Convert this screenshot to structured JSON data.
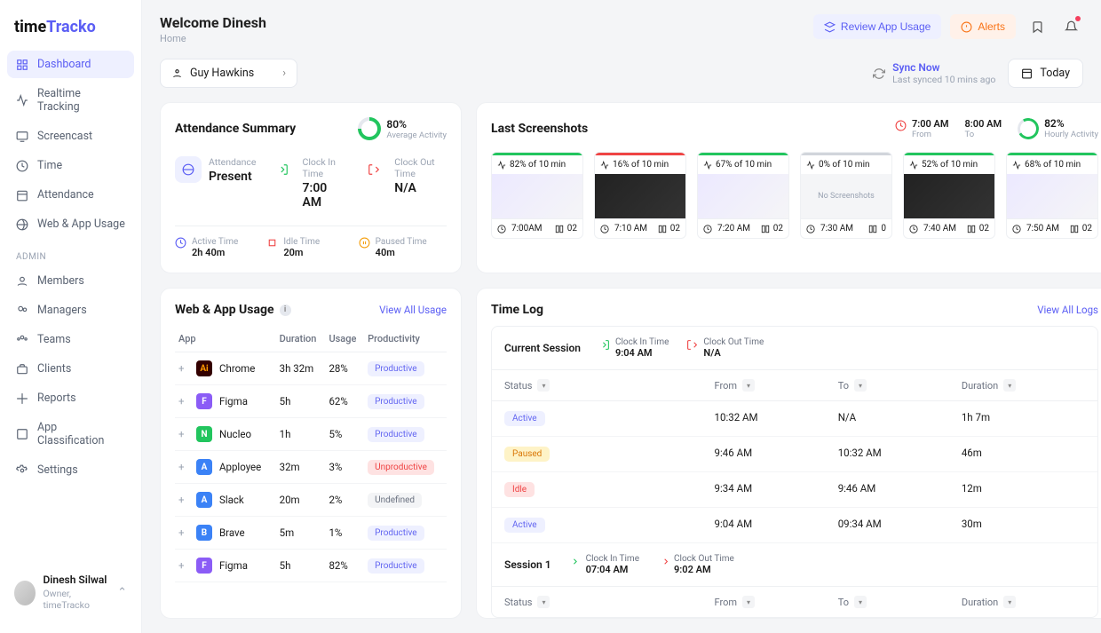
{
  "logo": {
    "pre": "time",
    "post": "Tracko"
  },
  "sidebar": {
    "items": [
      {
        "label": "Dashboard"
      },
      {
        "label": "Realtime Tracking"
      },
      {
        "label": "Screencast"
      },
      {
        "label": "Time"
      },
      {
        "label": "Attendance"
      },
      {
        "label": "Web & App Usage"
      }
    ],
    "admin_label": "ADMIN",
    "admin_items": [
      {
        "label": "Members"
      },
      {
        "label": "Managers"
      },
      {
        "label": "Teams"
      },
      {
        "label": "Clients"
      },
      {
        "label": "Reports"
      },
      {
        "label": "App Classification"
      },
      {
        "label": "Settings"
      }
    ]
  },
  "user": {
    "name": "Dinesh Silwal",
    "role": "Owner, timeTracko"
  },
  "header": {
    "welcome": "Welcome Dinesh",
    "breadcrumb": "Home",
    "review": "Review App Usage",
    "alerts": "Alerts"
  },
  "person_select": "Guy Hawkins",
  "sync": {
    "label": "Sync Now",
    "sub": "Last synced 10 mins ago"
  },
  "today": "Today",
  "attendance": {
    "title": "Attendance Summary",
    "pct": "80%",
    "pct_label": "Average Activity",
    "status_label": "Attendance",
    "status_val": "Present",
    "in_label": "Clock In Time",
    "in_val": "7:00 AM",
    "out_label": "Clock Out Time",
    "out_val": "N/A",
    "active_label": "Active Time",
    "active_val": "2h 40m",
    "idle_label": "Idle Time",
    "idle_val": "20m",
    "paused_label": "Paused Time",
    "paused_val": "40m"
  },
  "screenshots": {
    "title": "Last Screenshots",
    "from_val": "7:00 AM",
    "from_lbl": "From",
    "to_val": "8:00 AM",
    "to_lbl": "To",
    "hourly_pct": "82%",
    "hourly_lbl": "Hourly Activity",
    "items": [
      {
        "pct": "82% of 10 min",
        "time": "7:00AM",
        "count": "02",
        "bar": "green",
        "style": "light"
      },
      {
        "pct": "16% of 10 min",
        "time": "7:10 AM",
        "count": "02",
        "bar": "red",
        "style": "dark"
      },
      {
        "pct": "67% of 10 min",
        "time": "7:20 AM",
        "count": "02",
        "bar": "green",
        "style": "light"
      },
      {
        "pct": "0% of 10 min",
        "time": "7:30 AM",
        "count": "0",
        "bar": "grey",
        "style": "blank",
        "no_screenshot": "No Screenshots"
      },
      {
        "pct": "52% of 10 min",
        "time": "7:40 AM",
        "count": "02",
        "bar": "green",
        "style": "dark"
      },
      {
        "pct": "68% of 10 min",
        "time": "7:50 AM",
        "count": "02",
        "bar": "green",
        "style": "light"
      }
    ]
  },
  "usage": {
    "title": "Web & App Usage",
    "view_all": "View All Usage",
    "cols": {
      "app": "App",
      "duration": "Duration",
      "usage": "Usage",
      "prod": "Productivity"
    },
    "rows": [
      {
        "name": "Chrome",
        "icon": "Ai",
        "cls": "ai",
        "duration": "3h 32m",
        "usage": "28%",
        "prod": "Productive",
        "badge": "prod"
      },
      {
        "name": "Figma",
        "icon": "F",
        "cls": "pu",
        "duration": "5h",
        "usage": "62%",
        "prod": "Productive",
        "badge": "prod"
      },
      {
        "name": "Nucleo",
        "icon": "N",
        "cls": "gr",
        "duration": "1h",
        "usage": "5%",
        "prod": "Productive",
        "badge": "prod"
      },
      {
        "name": "Apployee",
        "icon": "A",
        "cls": "bl",
        "duration": "32m",
        "usage": "3%",
        "prod": "Unproductive",
        "badge": "unprod"
      },
      {
        "name": "Slack",
        "icon": "A",
        "cls": "bl",
        "duration": "20m",
        "usage": "2%",
        "prod": "Undefined",
        "badge": "undef"
      },
      {
        "name": "Brave",
        "icon": "B",
        "cls": "bl",
        "duration": "5m",
        "usage": "1%",
        "prod": "Productive",
        "badge": "prod"
      },
      {
        "name": "Figma",
        "icon": "F",
        "cls": "pu",
        "duration": "5h",
        "usage": "82%",
        "prod": "Productive",
        "badge": "prod"
      }
    ]
  },
  "timelog": {
    "title": "Time Log",
    "view_all": "View All Logs",
    "current": {
      "label": "Current Session",
      "in_lbl": "Clock In Time",
      "in_val": "9:04 AM",
      "out_lbl": "Clock Out Time",
      "out_val": "N/A"
    },
    "cols": {
      "status": "Status",
      "from": "From",
      "to": "To",
      "duration": "Duration"
    },
    "rows": [
      {
        "status": "Active",
        "cls": "active",
        "from": "10:32 AM",
        "to": "N/A",
        "dur": "1h 7m"
      },
      {
        "status": "Paused",
        "cls": "paused",
        "from": "9:46 AM",
        "to": "10:32 AM",
        "dur": "46m"
      },
      {
        "status": "Idle",
        "cls": "idle",
        "from": "9:34 AM",
        "to": "9:46 AM",
        "dur": "12m"
      },
      {
        "status": "Active",
        "cls": "active",
        "from": "9:04 AM",
        "to": "09:34 AM",
        "dur": "30m"
      }
    ],
    "session1": {
      "label": "Session 1",
      "in_lbl": "Clock In Time",
      "in_val": "07:04 AM",
      "out_lbl": "Clock Out Time",
      "out_val": "9:02 AM"
    }
  }
}
